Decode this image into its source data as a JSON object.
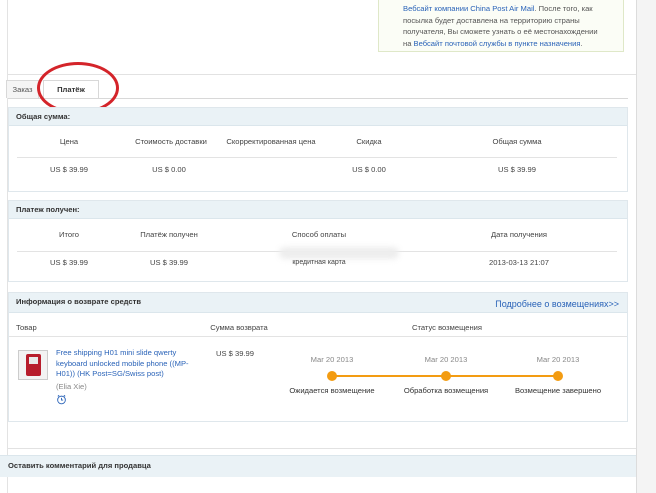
{
  "notice": {
    "line1": "Вебсайт компании China Post Air Mail",
    "line1_suffix": ". После того, как",
    "line2": "посылка будет доставлена на территорию страны",
    "line3": "получателя, Вы сможете узнать о её местонахождении",
    "line4_prefix": "на ",
    "line4_link": "Вебсайт почтовой службы в пункте назначения",
    "line4_suffix": "."
  },
  "tabs": [
    {
      "label": "Заказ"
    },
    {
      "label": "Платёж"
    }
  ],
  "total_panel": {
    "title": "Общая сумма:",
    "headers": [
      "Цена",
      "Стоимость доставки",
      "Скорректированная цена",
      "Скидка",
      "Общая сумма"
    ],
    "values": [
      "US $ 39.99",
      "US $ 0.00",
      "",
      "US $ 0.00",
      "US $ 39.99"
    ]
  },
  "received_panel": {
    "title": "Платеж получен:",
    "headers": [
      "Итого",
      "Платёж получен",
      "Способ оплаты",
      "Дата получения"
    ],
    "values": [
      "US $ 39.99",
      "US $ 39.99",
      "кредитная карта",
      "2013-03-13 21:07"
    ]
  },
  "refund_panel": {
    "title": "Информация о возврате средств",
    "link": "Подробнее о возмещениях>>",
    "col_product": "Товар",
    "col_amount": "Сумма возврата",
    "col_status": "Статус возмещения",
    "product_title": "Free shipping H01 mini slide qwerty keyboard unlocked mobile phone ((MP-H01)) (HK Post=SG/Swiss post)",
    "seller": "(Elia Xie)",
    "amount": "US $ 39.99",
    "steps": [
      {
        "date": "Mar 20 2013",
        "label": "Ожидается возмещение"
      },
      {
        "date": "Mar 20 2013",
        "label": "Обработка возмещения"
      },
      {
        "date": "Mar 20 2013",
        "label": "Возмещение завершено"
      }
    ]
  },
  "comment_bar": "Оставить комментарий для продавца",
  "colors": {
    "accent": "#f39c12",
    "link": "#2a63b8",
    "highlight": "#d4242a"
  }
}
